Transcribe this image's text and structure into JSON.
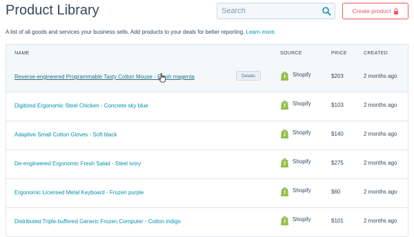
{
  "page": {
    "title": "Product Library",
    "description": "A list of all goods and services your business sells. Add products to your deals for better reporting.",
    "learn_more": "Learn more."
  },
  "search": {
    "placeholder": "Search",
    "icon": "search-icon"
  },
  "create_button": {
    "label": "Create product",
    "icon": "lock-icon",
    "color": "#f2545b"
  },
  "table": {
    "columns": {
      "name": "NAME",
      "source": "SOURCE",
      "price": "PRICE",
      "created": "CREATED"
    },
    "details_label": "Details",
    "rows": [
      {
        "name": "Reverse-engineered Programmable Tasty Cotton Mouse - Fresh magenta",
        "source": "Shopify",
        "price": "$203",
        "created": "2 months ago"
      },
      {
        "name": "Digitized Ergonomic Steel Chicken - Concrete sky blue",
        "source": "Shopify",
        "price": "$103",
        "created": "2 months ago"
      },
      {
        "name": "Adaptive Small Cotton Gloves - Soft black",
        "source": "Shopify",
        "price": "$140",
        "created": "2 months ago"
      },
      {
        "name": "De-engineered Ergonomic Fresh Salad - Steel ivory",
        "source": "Shopify",
        "price": "$275",
        "created": "2 months ago"
      },
      {
        "name": "Ergonomic Licensed Metal Keyboard - Frozen purple",
        "source": "Shopify",
        "price": "$60",
        "created": "2 months ago"
      },
      {
        "name": "Distributed Triple-buffered Generic Frozen Computer - Cotton indigo",
        "source": "Shopify",
        "price": "$101",
        "created": "2 months ago"
      }
    ]
  },
  "colors": {
    "link": "#0091ae",
    "accent": "#f2545b",
    "shopify": "#95bf47"
  }
}
